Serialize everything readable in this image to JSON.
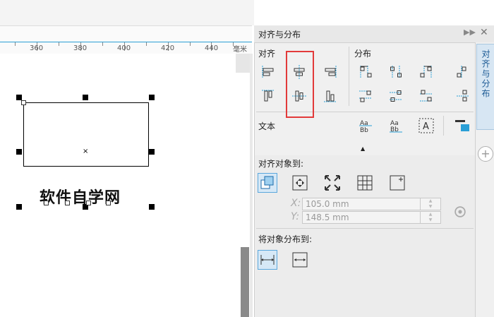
{
  "ruler": {
    "labels": [
      "360",
      "380",
      "400",
      "420",
      "440"
    ],
    "unit": "毫米"
  },
  "canvas": {
    "text": "软件自学网",
    "center_mark": "×"
  },
  "panel": {
    "title": "对齐与分布",
    "expand_glyph": "▶▶",
    "close_glyph": "✕",
    "side_tab_label": "对齐与分布",
    "add_tab_glyph": "+",
    "align_label": "对齐",
    "distribute_label": "分布",
    "text_label": "文本",
    "collapse_glyph": "▲",
    "align_to_label": "对齐对象到:",
    "x_letter": "X:",
    "y_letter": "Y:",
    "x_value": "105.0 mm",
    "y_value": "148.5 mm",
    "distribute_to_label": "将对象分布到:"
  },
  "colors": {
    "accent": "#2a9fd6",
    "highlight": "#e23a3a",
    "icon_dark": "#333333"
  }
}
